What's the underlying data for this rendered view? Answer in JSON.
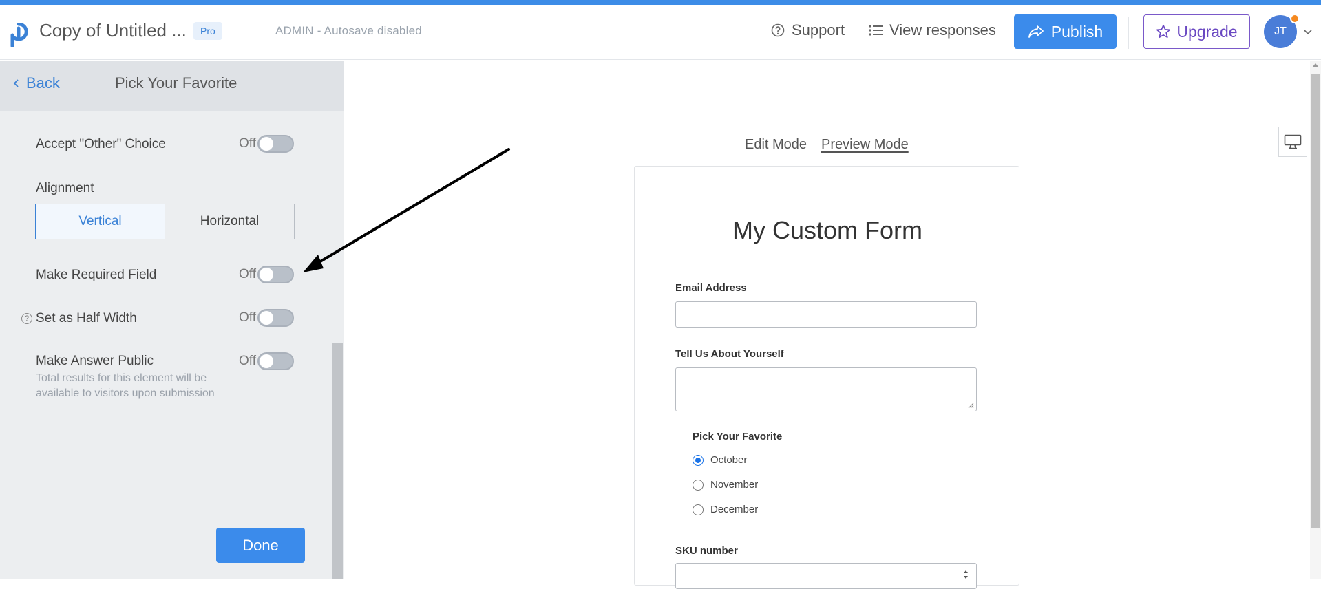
{
  "header": {
    "form_title": "Copy of Untitled ...",
    "badge": "Pro",
    "autosave_status": "ADMIN - Autosave disabled",
    "support_label": "Support",
    "view_responses_label": "View responses",
    "publish_label": "Publish",
    "upgrade_label": "Upgrade",
    "avatar_initials": "JT"
  },
  "sidebar": {
    "back_label": "Back",
    "title": "Pick Your Favorite",
    "accept_other_label": "Accept \"Other\" Choice",
    "alignment_label": "Alignment",
    "alignment_options": [
      "Vertical",
      "Horizontal"
    ],
    "alignment_selected": "Vertical",
    "required_label": "Make Required Field",
    "half_width_label": "Set as Half Width",
    "public_label": "Make Answer Public",
    "public_description": "Total results for this element will be available to visitors upon submission",
    "toggle_state": "Off",
    "done_label": "Done"
  },
  "modes": {
    "edit": "Edit Mode",
    "preview": "Preview Mode",
    "active": "Preview Mode"
  },
  "form": {
    "heading": "My Custom Form",
    "email_label": "Email Address",
    "about_label": "Tell Us About Yourself",
    "favorite_label": "Pick Your Favorite",
    "favorite_options": [
      "October",
      "November",
      "December"
    ],
    "favorite_selected": "October",
    "sku_label": "SKU number"
  },
  "colors": {
    "accent": "#3b8beb",
    "upgrade": "#6a48c2",
    "sidebar_bg": "#eceef0",
    "annotation_arrow": "#000000"
  },
  "icons": {
    "logo": "brand-logo-icon",
    "support": "question-circle-icon",
    "view_responses": "list-icon",
    "publish": "share-arrow-icon",
    "upgrade": "star-icon",
    "preview_device": "desktop-monitor-icon"
  }
}
